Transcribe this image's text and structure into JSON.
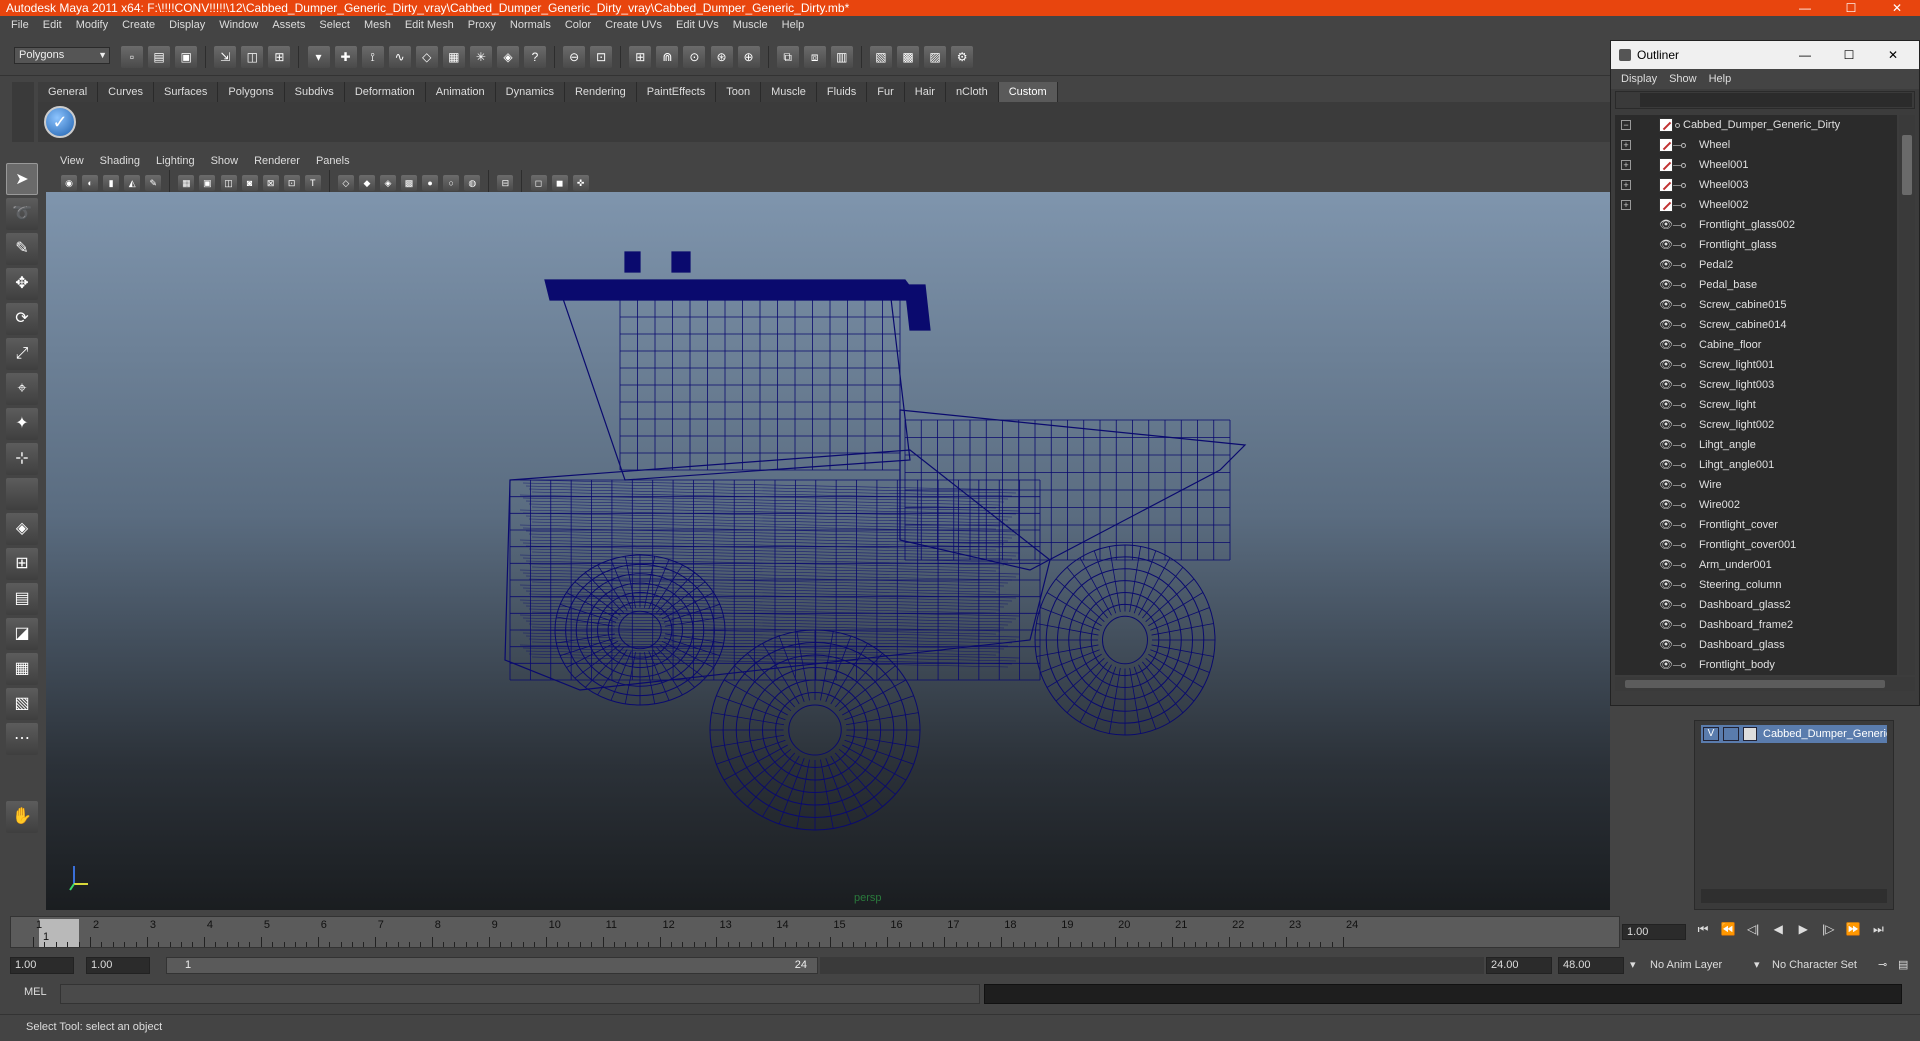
{
  "window": {
    "title": "Autodesk Maya 2011 x64: F:\\!!!!CONV!!!!!\\12\\Cabbed_Dumper_Generic_Dirty_vray\\Cabbed_Dumper_Generic_Dirty_vray\\Cabbed_Dumper_Generic_Dirty.mb*",
    "minimize": "—",
    "maximize": "☐",
    "close": "✕"
  },
  "menubar": [
    "File",
    "Edit",
    "Modify",
    "Create",
    "Display",
    "Window",
    "Assets",
    "Select",
    "Mesh",
    "Edit Mesh",
    "Proxy",
    "Normals",
    "Color",
    "Create UVs",
    "Edit UVs",
    "Muscle",
    "Help"
  ],
  "statusline": {
    "mode": "Polygons"
  },
  "shelf": {
    "tabs": [
      "General",
      "Curves",
      "Surfaces",
      "Polygons",
      "Subdivs",
      "Deformation",
      "Animation",
      "Dynamics",
      "Rendering",
      "PaintEffects",
      "Toon",
      "Muscle",
      "Fluids",
      "Fur",
      "Hair",
      "nCloth",
      "Custom"
    ],
    "active": "Custom"
  },
  "viewport": {
    "menu": [
      "View",
      "Shading",
      "Lighting",
      "Show",
      "Renderer",
      "Panels"
    ],
    "camera_label": "persp",
    "wire_color": "#0a0a6e"
  },
  "outliner": {
    "title": "Outliner",
    "menu": [
      "Display",
      "Show",
      "Help"
    ],
    "items": [
      {
        "name": "Cabbed_Dumper_Generic_Dirty",
        "kind": "root"
      },
      {
        "name": "Wheel",
        "kind": "group"
      },
      {
        "name": "Wheel001",
        "kind": "group"
      },
      {
        "name": "Wheel003",
        "kind": "group"
      },
      {
        "name": "Wheel002",
        "kind": "group"
      },
      {
        "name": "Frontlight_glass002",
        "kind": "mesh"
      },
      {
        "name": "Frontlight_glass",
        "kind": "mesh"
      },
      {
        "name": "Pedal2",
        "kind": "mesh"
      },
      {
        "name": "Pedal_base",
        "kind": "mesh"
      },
      {
        "name": "Screw_cabine015",
        "kind": "mesh"
      },
      {
        "name": "Screw_cabine014",
        "kind": "mesh"
      },
      {
        "name": "Cabine_floor",
        "kind": "mesh"
      },
      {
        "name": "Screw_light001",
        "kind": "mesh"
      },
      {
        "name": "Screw_light003",
        "kind": "mesh"
      },
      {
        "name": "Screw_light",
        "kind": "mesh"
      },
      {
        "name": "Screw_light002",
        "kind": "mesh"
      },
      {
        "name": "Lihgt_angle",
        "kind": "mesh"
      },
      {
        "name": "Lihgt_angle001",
        "kind": "mesh"
      },
      {
        "name": "Wire",
        "kind": "mesh"
      },
      {
        "name": "Wire002",
        "kind": "mesh"
      },
      {
        "name": "Frontlight_cover",
        "kind": "mesh"
      },
      {
        "name": "Frontlight_cover001",
        "kind": "mesh"
      },
      {
        "name": "Arm_under001",
        "kind": "mesh"
      },
      {
        "name": "Steering_column",
        "kind": "mesh"
      },
      {
        "name": "Dashboard_glass2",
        "kind": "mesh"
      },
      {
        "name": "Dashboard_frame2",
        "kind": "mesh"
      },
      {
        "name": "Dashboard_glass",
        "kind": "mesh"
      },
      {
        "name": "Frontlight_body",
        "kind": "mesh"
      }
    ]
  },
  "layers": {
    "visible_flag": "V",
    "layer_name": "Cabbed_Dumper_Generic"
  },
  "timeline": {
    "ticks": [
      "1",
      "2",
      "3",
      "4",
      "5",
      "6",
      "7",
      "8",
      "9",
      "10",
      "11",
      "12",
      "13",
      "14",
      "15",
      "16",
      "17",
      "18",
      "19",
      "20",
      "21",
      "22",
      "23",
      "24"
    ],
    "current_frame": "1",
    "current_time": "1.00"
  },
  "range": {
    "start_time": "1.00",
    "playback_start": "1.00",
    "range_start_label": "1",
    "range_end_label": "24",
    "playback_end": "24.00",
    "end_time": "48.00",
    "anim_layer": "No Anim Layer",
    "character_set": "No Character Set"
  },
  "command": {
    "label": "MEL"
  },
  "help_line": {
    "text": "Select Tool: select an object"
  }
}
